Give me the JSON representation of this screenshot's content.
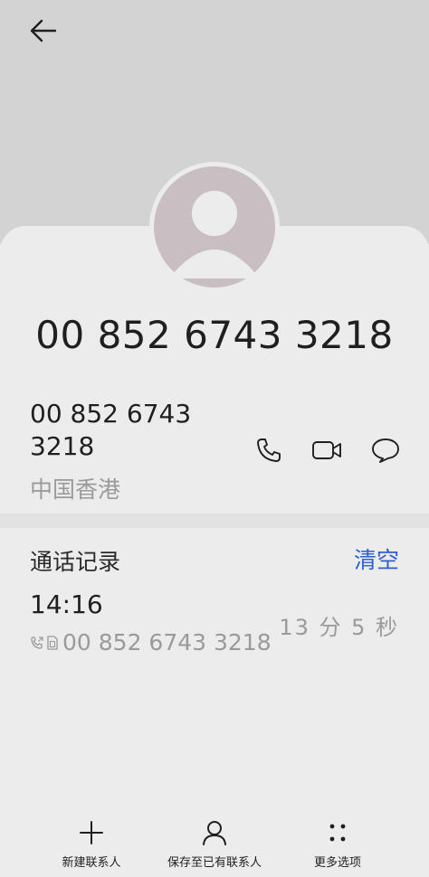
{
  "header": {
    "back_icon": "arrow-left-icon"
  },
  "contact": {
    "title_number": "00 852 6743 3218",
    "number_line1": "00 852 6743",
    "number_line2": "3218",
    "region": "中国香港",
    "actions": [
      {
        "icon": "phone-icon"
      },
      {
        "icon": "video-call-icon"
      },
      {
        "icon": "message-icon"
      }
    ]
  },
  "call_log": {
    "title": "通话记录",
    "clear_label": "清空",
    "entries": [
      {
        "time": "14:16",
        "number": "00 852 6743 3218",
        "duration": "13 分 5 秒"
      }
    ]
  },
  "bottom_bar": {
    "items": [
      {
        "label": "新建联系人",
        "icon": "plus-icon"
      },
      {
        "label": "保存至已有联系人",
        "icon": "person-icon"
      },
      {
        "label": "更多选项",
        "icon": "more-dots-icon"
      }
    ]
  },
  "colors": {
    "accent": "#2f5fd0",
    "header_bg": "#d3d3d3",
    "page_bg": "#ececec",
    "avatar_bg": "#c9bfc2"
  }
}
